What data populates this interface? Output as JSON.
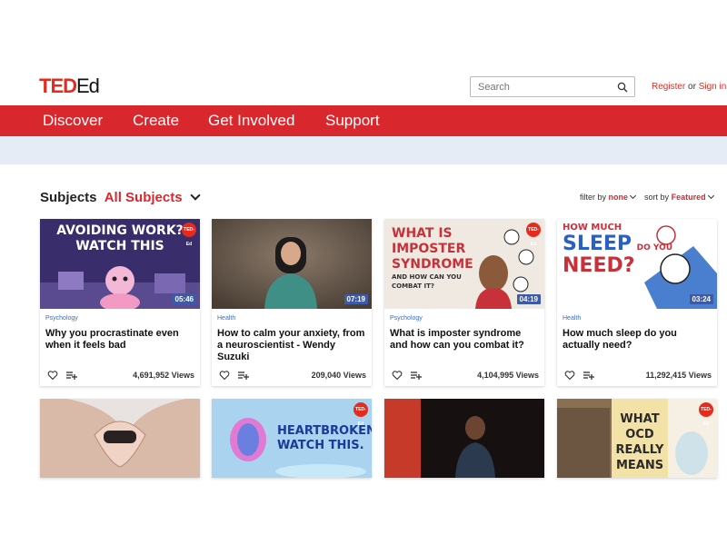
{
  "logo": {
    "ted": "TED",
    "ed": "Ed"
  },
  "search": {
    "placeholder": "Search"
  },
  "auth": {
    "register": "Register",
    "or": "or",
    "signin": "Sign in"
  },
  "nav": [
    "Discover",
    "Create",
    "Get Involved",
    "Support"
  ],
  "subjects": {
    "label": "Subjects",
    "selected": "All Subjects"
  },
  "filters": {
    "filter_label": "filter by",
    "filter_value": "none",
    "sort_label": "sort by",
    "sort_value": "Featured"
  },
  "badge": "TED-Ed",
  "cards": [
    {
      "category": "Psychology",
      "title": "Why you procrastinate even when it feels bad",
      "views": "4,691,952 Views",
      "duration": "05:46",
      "thumb_text": [
        "AVOIDING WORK?",
        "WATCH THIS"
      ]
    },
    {
      "category": "Health",
      "title": "How to calm your anxiety, from a neuroscientist - Wendy Suzuki",
      "views": "209,040 Views",
      "duration": "07:19"
    },
    {
      "category": "Psychology",
      "title": "What is imposter syndrome and how can you combat it?",
      "views": "4,104,995 Views",
      "duration": "04:19",
      "thumb_text": [
        "WHAT IS",
        "IMPOSTER",
        "SYNDROME",
        "AND HOW CAN YOU",
        "COMBAT IT?"
      ]
    },
    {
      "category": "Health",
      "title": "How much sleep do you actually need?",
      "views": "11,292,415 Views",
      "duration": "03:24",
      "thumb_text": [
        "HOW MUCH",
        "SLEEP",
        "DO YOU",
        "NEED?"
      ]
    }
  ],
  "row2": [
    {
      "thumb_text": []
    },
    {
      "thumb_text": [
        "HEARTBROKEN?",
        "WATCH THIS."
      ]
    },
    {
      "thumb_text": []
    },
    {
      "thumb_text": [
        "WHAT",
        "OCD",
        "REALLY",
        "MEANS"
      ]
    }
  ],
  "colors": {
    "brand_red": "#d9272e",
    "band": "#e6ecf6",
    "duration_badge": "#3d5aa8",
    "category_blue": "#3d6cc0"
  }
}
